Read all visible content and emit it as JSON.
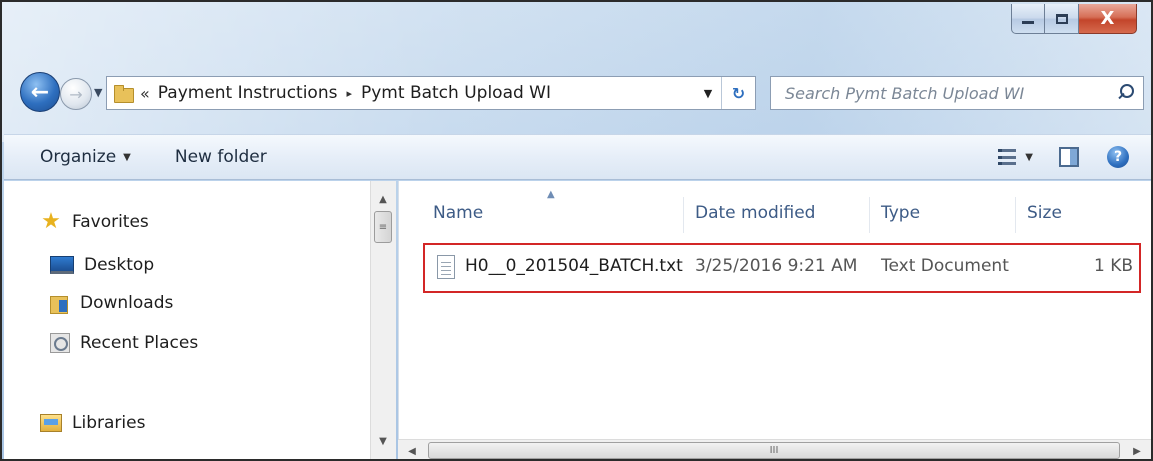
{
  "window": {
    "caption": {
      "minimize_glyph": "",
      "close_glyph": "X"
    }
  },
  "navigation": {
    "back_glyph": "←",
    "forward_glyph": "→",
    "recent_glyph": "▼"
  },
  "address_bar": {
    "overflow_glyph": "«",
    "breadcrumbs": [
      "Payment Instructions",
      "Pymt Batch Upload WI"
    ],
    "separator_glyph": "▸",
    "dropdown_glyph": "▼",
    "refresh_glyph": "↻"
  },
  "search": {
    "placeholder": "Search Pymt Batch Upload WI"
  },
  "toolbar": {
    "organize_label": "Organize",
    "organize_caret": "▼",
    "new_folder_label": "New folder",
    "view_caret": "▼",
    "help_glyph": "?"
  },
  "nav_pane": {
    "favorites": "Favorites",
    "items": [
      "Desktop",
      "Downloads",
      "Recent Places"
    ],
    "libraries": "Libraries"
  },
  "file_list": {
    "columns": [
      "Name",
      "Date modified",
      "Type",
      "Size"
    ],
    "sort_glyph": "▲",
    "rows": [
      {
        "name": "H0__0_201504_BATCH.txt",
        "date_modified": "3/25/2016 9:21 AM",
        "type": "Text Document",
        "size": "1 KB"
      }
    ]
  },
  "scrollbars": {
    "grip_glyph": "≡",
    "h_grip_glyph": "III",
    "up": "▲",
    "down": "▼",
    "left": "◀",
    "right": "▶"
  },
  "colors": {
    "selection_outline": "#d32626",
    "column_header_text": "#3d5b86"
  }
}
